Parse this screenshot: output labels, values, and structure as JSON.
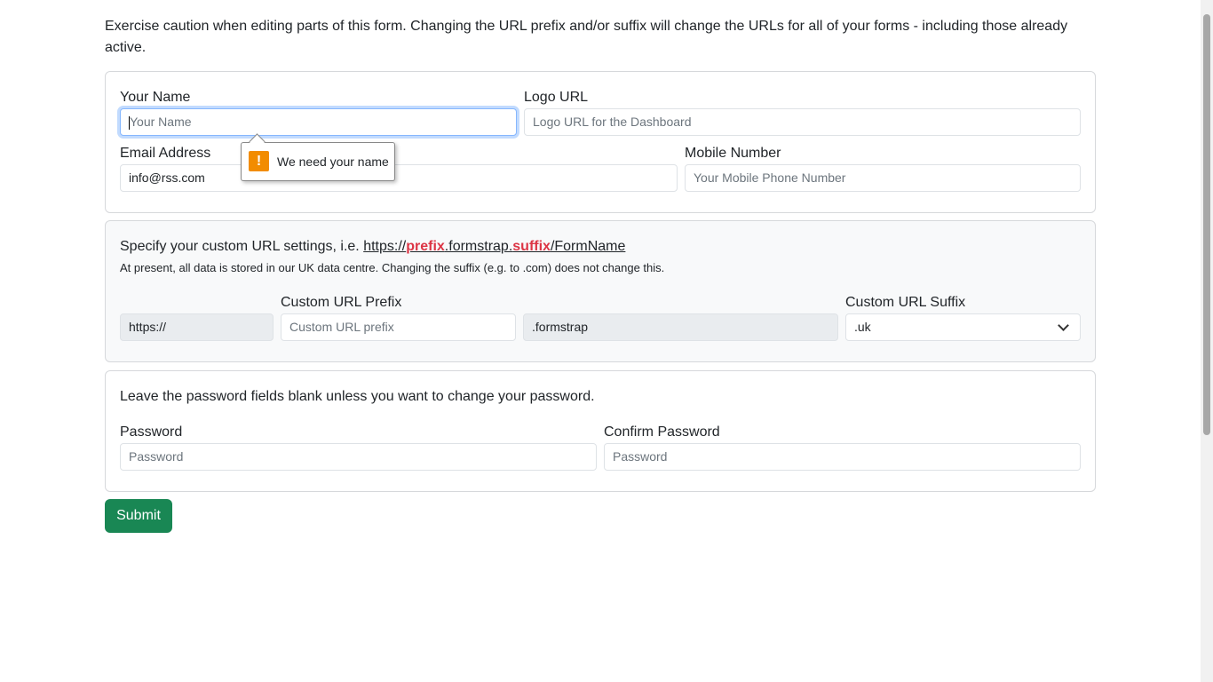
{
  "intro": "Exercise caution when editing parts of this form. Changing the URL prefix and/or suffix will change the URLs for all of your forms - including those already active.",
  "profile": {
    "name_label": "Your Name",
    "name_placeholder": "Your Name",
    "logo_label": "Logo URL",
    "logo_placeholder": "Logo URL for the Dashboard",
    "email_label": "Email Address",
    "email_value": "info@rss.com",
    "mobile_label": "Mobile Number",
    "mobile_placeholder": "Your Mobile Phone Number",
    "validation_tooltip": "We need your name"
  },
  "url": {
    "intro_prefix": "Specify your custom URL settings, i.e. ",
    "example": {
      "scheme": "https://",
      "prefix": "prefix",
      "domain": ".formstrap.",
      "suffix": "suffix",
      "path": "/FormName"
    },
    "note": "At present, all data is stored in our UK data centre. Changing the suffix (e.g. to .com) does not change this.",
    "scheme_value": "https://",
    "prefix_label": "Custom URL Prefix",
    "prefix_placeholder": "Custom URL prefix",
    "domain_value": ".formstrap",
    "suffix_label": "Custom URL Suffix",
    "suffix_value": ".uk"
  },
  "password": {
    "note": "Leave the password fields blank unless you want to change your password.",
    "password_label": "Password",
    "password_placeholder": "Password",
    "confirm_label": "Confirm Password",
    "confirm_placeholder": "Password"
  },
  "submit_label": "Submit",
  "colors": {
    "submit": "#198754",
    "highlight": "#dc3545",
    "warning": "#f28c00"
  }
}
